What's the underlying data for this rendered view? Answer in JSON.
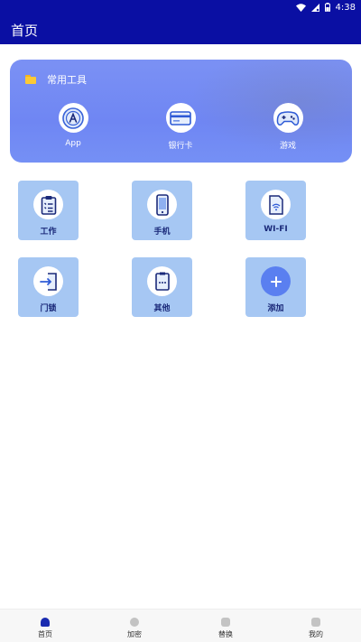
{
  "status": {
    "time": "4:38"
  },
  "appbar": {
    "title": "首页"
  },
  "tools_card": {
    "title": "常用工具",
    "items": [
      {
        "label": "App",
        "icon": "app-store-icon"
      },
      {
        "label": "银行卡",
        "icon": "bank-card-icon"
      },
      {
        "label": "游戏",
        "icon": "gamepad-icon"
      }
    ]
  },
  "grid": [
    {
      "label": "工作",
      "icon": "clipboard-icon"
    },
    {
      "label": "手机",
      "icon": "phone-icon"
    },
    {
      "label": "WI-FI",
      "icon": "wifi-file-icon"
    },
    {
      "label": "门锁",
      "icon": "door-login-icon"
    },
    {
      "label": "其他",
      "icon": "other-icon"
    },
    {
      "label": "添加",
      "icon": "add-icon"
    }
  ],
  "bottom_nav": [
    {
      "label": "首页",
      "active": true
    },
    {
      "label": "加密",
      "active": false
    },
    {
      "label": "替换",
      "active": false
    },
    {
      "label": "我的",
      "active": false
    }
  ],
  "colors": {
    "primary": "#0a0fa3",
    "card": "#7289f4",
    "tile": "#a6c7f3",
    "accent": "#5a7ff0"
  }
}
